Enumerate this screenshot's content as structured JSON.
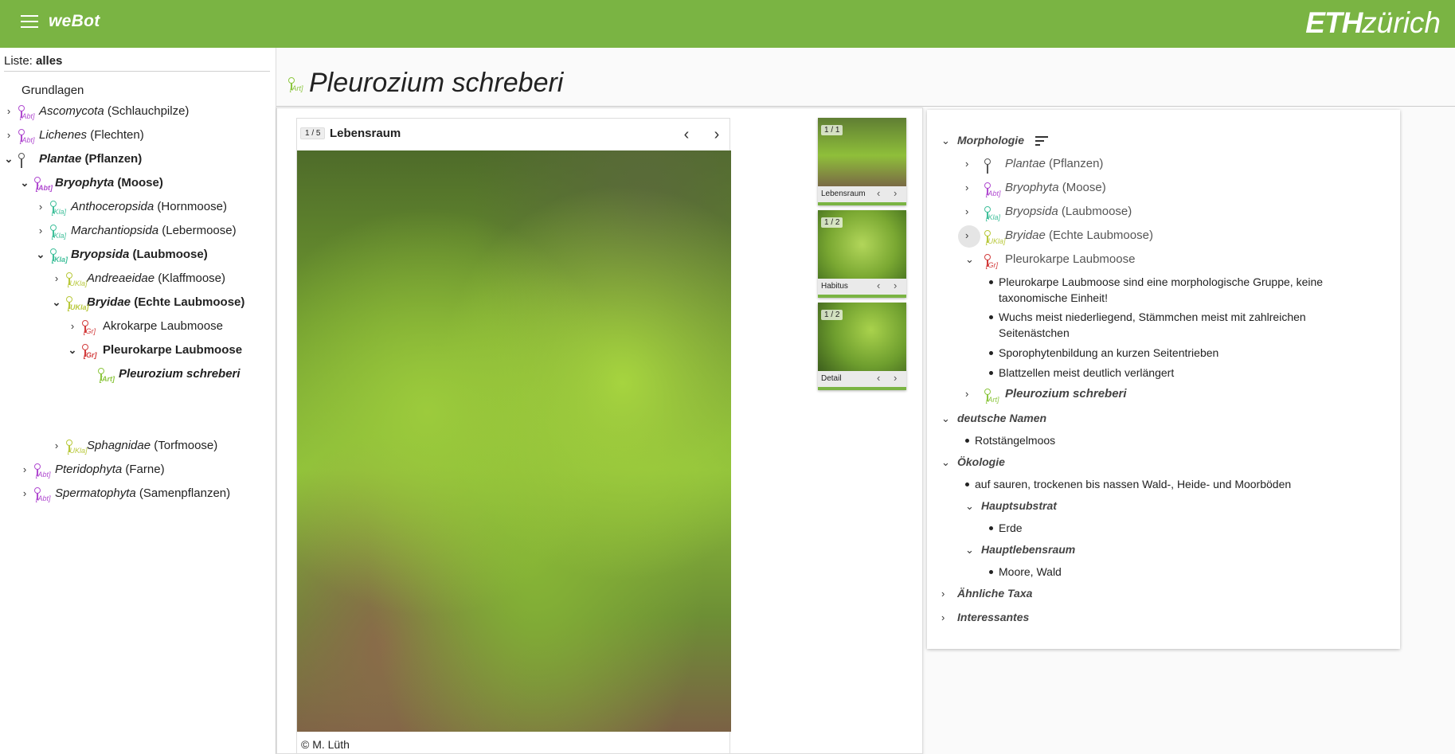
{
  "header": {
    "app_title": "weBot",
    "brand_bold": "ETH",
    "brand_light": "zürich"
  },
  "sidebar": {
    "list_prefix": "Liste:",
    "list_value": "alles",
    "items": [
      {
        "label": "Grundlagen"
      },
      {
        "sci": "Ascomycota",
        "common": " (Schlauchpilze)",
        "rank": "[Abt]"
      },
      {
        "sci": "Lichenes",
        "common": " (Flechten)",
        "rank": "[Abt]"
      },
      {
        "sci": "Plantae",
        "common": " (Pflanzen)",
        "rank": ""
      },
      {
        "sci": "Bryophyta",
        "common": " (Moose)",
        "rank": "[Abt]"
      },
      {
        "sci": "Anthoceropsida",
        "common": " (Hornmoose)",
        "rank": "[Kla]"
      },
      {
        "sci": "Marchantiopsida",
        "common": " (Lebermoose)",
        "rank": "[Kla]"
      },
      {
        "sci": "Bryopsida",
        "common": " (Laubmoose)",
        "rank": "[Kla]"
      },
      {
        "sci": "Andreaeidae",
        "common": " (Klaffmoose)",
        "rank": "[UKla]"
      },
      {
        "sci": "Bryidae",
        "common": " (Echte Laubmoose)",
        "rank": "[UKla]"
      },
      {
        "label": "Akrokarpe Laubmoose",
        "rank": "[Gr]"
      },
      {
        "label": "Pleurokarpe Laubmoose",
        "rank": "[Gr]"
      },
      {
        "sci": "Pleurozium schreberi",
        "rank": "[Art]"
      },
      {
        "sci": "Sphagnidae",
        "common": " (Torfmoose)",
        "rank": "[UKla]"
      },
      {
        "sci": "Pteridophyta",
        "common": " (Farne)",
        "rank": "[Abt]"
      },
      {
        "sci": "Spermatophyta",
        "common": " (Samenpflanzen)",
        "rank": "[Abt]"
      }
    ]
  },
  "page": {
    "title": "Pleurozium schreberi",
    "rank": "[Art]"
  },
  "gallery": {
    "counter": "1 / 5",
    "caption": "Lebensraum",
    "prev": "‹",
    "next": "›",
    "copyright": "© M. Lüth",
    "thumbs": [
      {
        "count": "1 / 1",
        "label": "Lebensraum"
      },
      {
        "count": "1 / 2",
        "label": "Habitus"
      },
      {
        "count": "1 / 2",
        "label": "Detail"
      }
    ]
  },
  "details": {
    "morphologie": "Morphologie",
    "path": [
      {
        "sci": "Plantae",
        "common": " (Pflanzen)",
        "rank": ""
      },
      {
        "sci": "Bryophyta",
        "common": " (Moose)",
        "rank": "[Abt]"
      },
      {
        "sci": "Bryopsida",
        "common": " (Laubmoose)",
        "rank": "[Kla]"
      },
      {
        "sci": "Bryidae",
        "common": " (Echte Laubmoose)",
        "rank": "[UKla]"
      },
      {
        "label": "Pleurokarpe Laubmoose",
        "rank": "[Gr]"
      }
    ],
    "bullets": [
      [
        "Pleurokarpe Laubmoose sind eine morphologische Gruppe, keine",
        "taxonomische Einheit!"
      ],
      [
        "Wuchs meist niederliegend, Stämmchen meist mit zahlreichen",
        "Seitenästchen"
      ],
      [
        "Sporophytenbildung an kurzen Seitentrieben"
      ],
      [
        "Blattzellen meist deutlich verlängert"
      ]
    ],
    "species": {
      "sci": "Pleurozium schreberi",
      "rank": "[Art]"
    },
    "deutsche_namen": "deutsche Namen",
    "deutsche_namen_item": "Rotstängelmoos",
    "oekologie": "Ökologie",
    "oekologie_item": "auf sauren, trockenen bis nassen Wald-, Heide- und Moorböden",
    "hauptsubstrat": "Hauptsubstrat",
    "hauptsubstrat_item": "Erde",
    "hauptlebensraum": "Hauptlebensraum",
    "hauptlebensraum_item": "Moore, Wald",
    "aehnliche": "Ähnliche Taxa",
    "interessantes": "Interessantes"
  },
  "colors": {
    "accent": "#7ab443",
    "abt": "#b04ad0",
    "kla": "#3fbf9a",
    "ukla": "#b8c83a",
    "gr": "#d23c3c",
    "art": "#8cc63f",
    "plantae": "#555555"
  }
}
